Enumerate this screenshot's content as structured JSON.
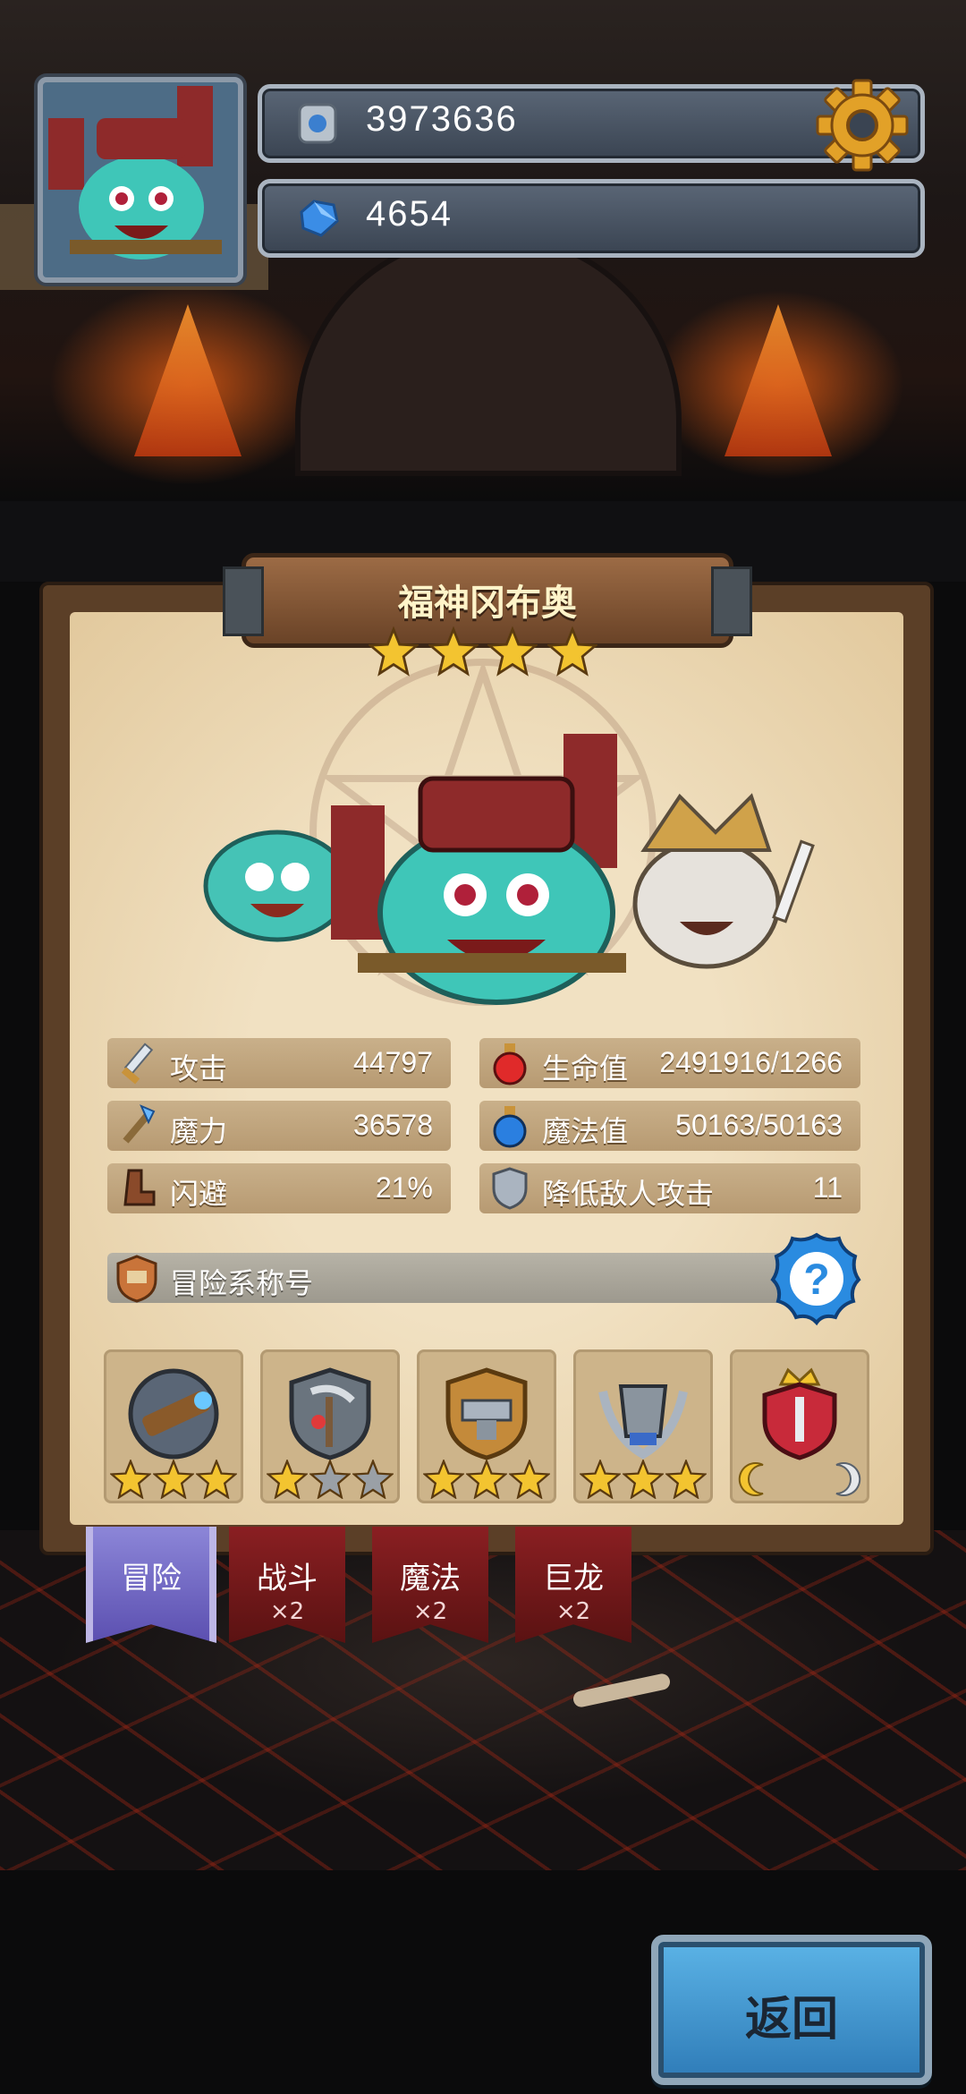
{
  "header": {
    "gold_value": "3973636",
    "gem_value": "4654",
    "settings_icon": "gear-icon",
    "avatar_icon": "hero-avatar-icon"
  },
  "hero": {
    "name": "福神冈布奥",
    "star_count": 4
  },
  "stats": [
    {
      "icon": "sword-icon",
      "label": "攻击",
      "value": "44797"
    },
    {
      "icon": "potion-red-icon",
      "label": "生命值",
      "value": "2491916/1266"
    },
    {
      "icon": "staff-icon",
      "label": "魔力",
      "value": "36578"
    },
    {
      "icon": "potion-blue-icon",
      "label": "魔法值",
      "value": "50163/50163"
    },
    {
      "icon": "boot-icon",
      "label": "闪避",
      "value": "21%"
    },
    {
      "icon": "shield-icon",
      "label": "降低敌人攻击",
      "value": "11"
    }
  ],
  "title_section": {
    "label": "冒险系称号",
    "help_icon": "question-icon"
  },
  "badges": [
    {
      "icon": "telescope-badge-icon",
      "stars_filled": 3,
      "stars_total": 3
    },
    {
      "icon": "scythe-badge-icon",
      "stars_filled": 1,
      "stars_total": 3
    },
    {
      "icon": "anvil-badge-icon",
      "stars_filled": 3,
      "stars_total": 3
    },
    {
      "icon": "armor-badge-icon",
      "stars_filled": 3,
      "stars_total": 3
    },
    {
      "icon": "crown-badge-icon",
      "stars_filled": 0,
      "stars_total": 0
    }
  ],
  "tabs": [
    {
      "label": "冒险",
      "mult": "",
      "active": true
    },
    {
      "label": "战斗",
      "mult": "×2",
      "active": false
    },
    {
      "label": "魔法",
      "mult": "×2",
      "active": false
    },
    {
      "label": "巨龙",
      "mult": "×2",
      "active": false
    }
  ],
  "back_button": {
    "label": "返回"
  },
  "colors": {
    "star_gold": "#f3c430",
    "star_grey": "#9aa0a6",
    "help_blue": "#2a8be0",
    "tab_active": "#6b5fc0",
    "tab_inactive": "#7a1a1c"
  }
}
